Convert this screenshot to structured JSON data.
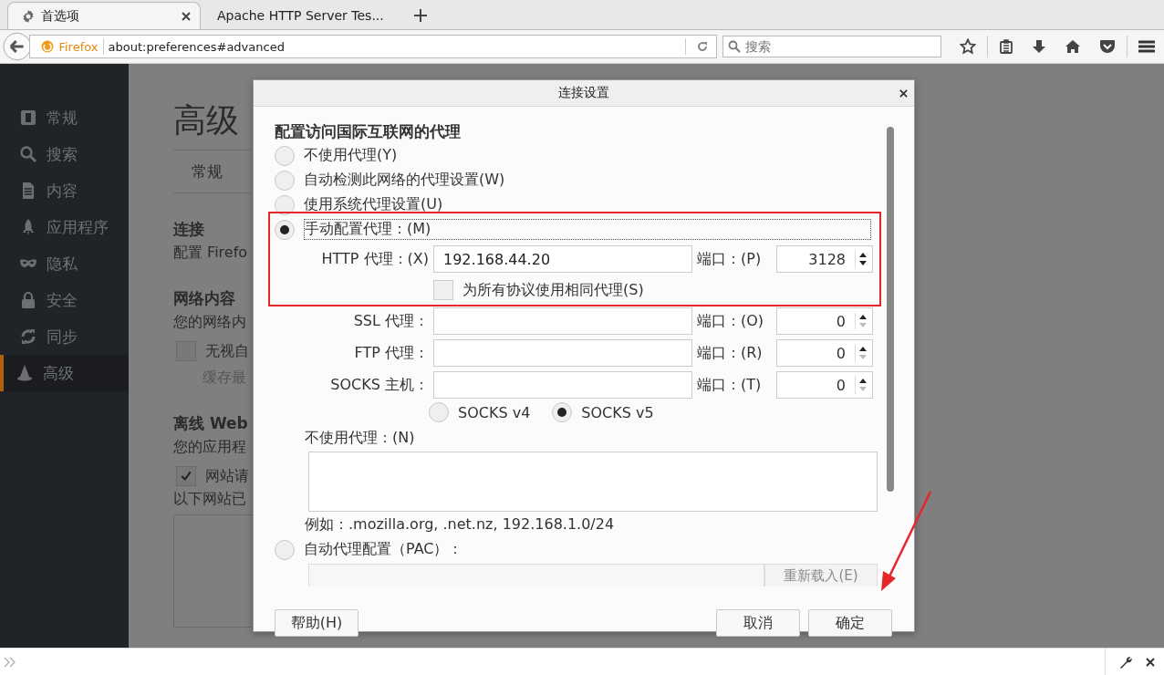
{
  "browser": {
    "tabs": [
      {
        "label": "首选项",
        "selected": true
      },
      {
        "label": "Apache HTTP Server Tes...",
        "selected": false
      }
    ],
    "identity": "Firefox",
    "url": "about:preferences#advanced",
    "search_placeholder": "搜索"
  },
  "sidebar": {
    "items": [
      {
        "label": "常规",
        "selected": false
      },
      {
        "label": "搜索",
        "selected": false
      },
      {
        "label": "内容",
        "selected": false
      },
      {
        "label": "应用程序",
        "selected": false
      },
      {
        "label": "隐私",
        "selected": false
      },
      {
        "label": "安全",
        "selected": false
      },
      {
        "label": "同步",
        "selected": false
      },
      {
        "label": "高级",
        "selected": true
      }
    ]
  },
  "page": {
    "heading": "高级",
    "subtab": "常规",
    "sections": [
      {
        "kind": "heading",
        "text": "连接"
      },
      {
        "kind": "text",
        "text": "配置 Firefo"
      },
      {
        "kind": "heading",
        "text": "网络内容"
      },
      {
        "kind": "text",
        "text": "您的网络内"
      },
      {
        "kind": "checkbox",
        "text": "无视自",
        "checked": false
      },
      {
        "kind": "note",
        "text": "缓存最"
      },
      {
        "kind": "heading",
        "text": "离线 Web"
      },
      {
        "kind": "text",
        "text": "您的应用程"
      },
      {
        "kind": "checkbox",
        "text": "网站请",
        "checked": true
      },
      {
        "kind": "text",
        "text": "以下网站已"
      },
      {
        "kind": "listbox"
      }
    ]
  },
  "dialog": {
    "title": "连接设置",
    "heading": "配置访问国际互联网的代理",
    "modes": [
      {
        "label": "不使用代理(Y)",
        "selected": false
      },
      {
        "label": "自动检测此网络的代理设置(W)",
        "selected": false
      },
      {
        "label": "使用系统代理设置(U)",
        "selected": false
      },
      {
        "label": "手动配置代理：(M)",
        "selected": true
      }
    ],
    "proxies": [
      {
        "label": "HTTP 代理：(X)",
        "value": "192.168.44.20",
        "port_label": "端口：(P)",
        "port": "3128"
      },
      {
        "label": "SSL 代理：",
        "port_label": "端口：(O)",
        "port": "0"
      },
      {
        "label": "FTP 代理：",
        "port_label": "端口：(R)",
        "port": "0"
      },
      {
        "label": "SOCKS 主机：",
        "port_label": "端口：(T)",
        "port": "0"
      }
    ],
    "same_for_all": {
      "label": "为所有协议使用相同代理(S)",
      "checked": false
    },
    "socks_versions": [
      {
        "label": "SOCKS v4",
        "selected": false
      },
      {
        "label": "SOCKS v5",
        "selected": true
      }
    ],
    "no_proxy_label": "不使用代理：(N)",
    "example": "例如：.mozilla.org, .net.nz, 192.168.1.0/24",
    "pac": {
      "label": "自动代理配置（PAC）：",
      "selected": false,
      "reload": "重新载入(E)",
      "reload_disabled": true
    },
    "buttons": {
      "help": "帮助(H)",
      "cancel": "取消",
      "ok": "确定"
    }
  }
}
